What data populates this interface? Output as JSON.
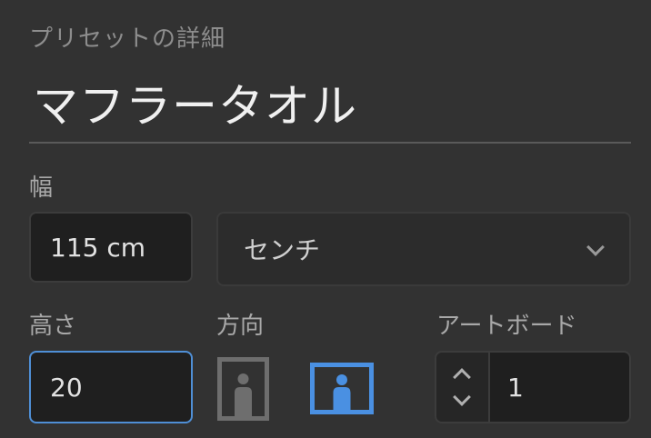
{
  "section_title": "プリセットの詳細",
  "preset_name": "マフラータオル",
  "width": {
    "label": "幅",
    "value": "115 cm",
    "unit_selected": "センチ"
  },
  "height": {
    "label": "高さ",
    "value": "20"
  },
  "orientation": {
    "label": "方向",
    "options": [
      "portrait-icon",
      "landscape-icon"
    ],
    "selected": "landscape"
  },
  "artboard": {
    "label": "アートボード",
    "value": "1"
  },
  "colors": {
    "background": "#323232",
    "accent": "#4a90e2",
    "focus_border": "#4f8fd6",
    "inactive_icon": "#6e6e6e"
  }
}
